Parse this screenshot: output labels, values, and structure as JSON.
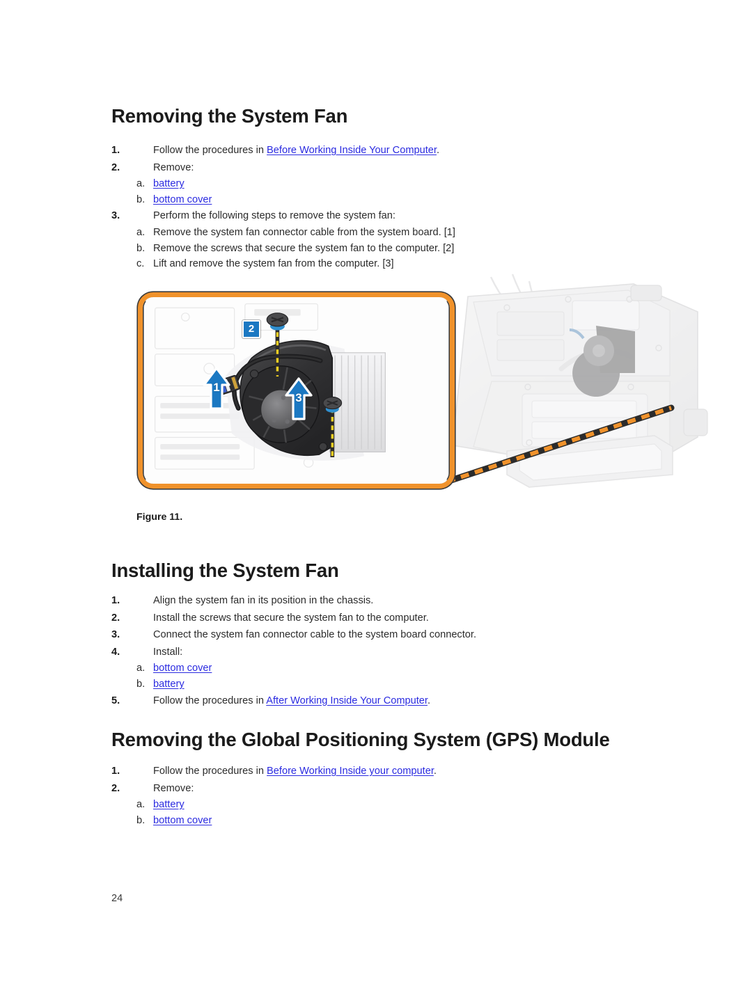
{
  "page": {
    "number": "24"
  },
  "sections": [
    {
      "heading": "Removing the System Fan",
      "steps": [
        {
          "marker": "1.",
          "pre": "Follow the procedures in ",
          "link": "Before Working Inside Your Computer",
          "post": "."
        },
        {
          "marker": "2.",
          "pre": "Remove:",
          "link": "",
          "post": ""
        },
        {
          "marker": "a.",
          "pre": "",
          "link": "battery",
          "post": "",
          "sub": true
        },
        {
          "marker": "b.",
          "pre": "",
          "link": "bottom cover",
          "post": "",
          "sub": true
        },
        {
          "marker": "3.",
          "pre": "Perform the following steps to remove the system fan:",
          "link": "",
          "post": ""
        },
        {
          "marker": "a.",
          "pre": "Remove the system fan connector cable from the system board. [1]",
          "link": "",
          "post": "",
          "sub": true
        },
        {
          "marker": "b.",
          "pre": "Remove the screws that secure the system fan to the computer. [2]",
          "link": "",
          "post": "",
          "sub": true
        },
        {
          "marker": "c.",
          "pre": "Lift and remove the system fan from the computer. [3]",
          "link": "",
          "post": "",
          "sub": true
        }
      ]
    },
    {
      "heading": "Installing the System Fan",
      "steps": [
        {
          "marker": "1.",
          "pre": "Align the system fan in its position in the chassis.",
          "link": "",
          "post": ""
        },
        {
          "marker": "2.",
          "pre": "Install the screws that secure the system fan to the computer.",
          "link": "",
          "post": ""
        },
        {
          "marker": "3.",
          "pre": "Connect the system fan connector cable to the system board connector.",
          "link": "",
          "post": ""
        },
        {
          "marker": "4.",
          "pre": "Install:",
          "link": "",
          "post": ""
        },
        {
          "marker": "a.",
          "pre": "",
          "link": "bottom cover",
          "post": "",
          "sub": true
        },
        {
          "marker": "b.",
          "pre": "",
          "link": "battery",
          "post": "",
          "sub": true
        },
        {
          "marker": "5.",
          "pre": "Follow the procedures in ",
          "link": "After Working Inside Your Computer",
          "post": "."
        }
      ]
    },
    {
      "heading": "Removing the Global Positioning System (GPS) Module",
      "steps": [
        {
          "marker": "1.",
          "pre": "Follow the procedures in ",
          "link": "Before Working Inside your computer",
          "post": "."
        },
        {
          "marker": "2.",
          "pre": "Remove:",
          "link": "",
          "post": ""
        },
        {
          "marker": "a.",
          "pre": "",
          "link": "battery",
          "post": "",
          "sub": true
        },
        {
          "marker": "b.",
          "pre": "",
          "link": "bottom cover",
          "post": "",
          "sub": true
        }
      ]
    }
  ],
  "figure": {
    "caption": "Figure 11.",
    "callouts": [
      {
        "id": "1",
        "type": "arrow",
        "meaning": "system fan connector cable"
      },
      {
        "id": "2",
        "type": "square",
        "meaning": "screws"
      },
      {
        "id": "3",
        "type": "arrow",
        "meaning": "system fan lift direction"
      }
    ],
    "border_color": "#f0922b",
    "callout_color": "#1b78c2"
  }
}
